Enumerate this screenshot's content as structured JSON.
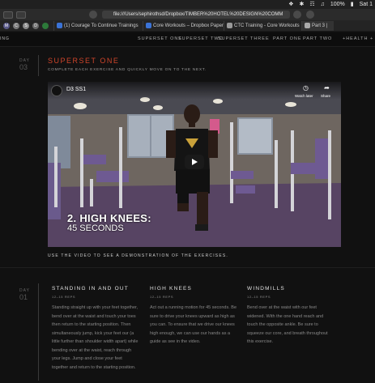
{
  "menubar": {
    "battery": "100%",
    "clock": "Sat 1"
  },
  "toolbar": {
    "address": "file:///Users/sephirothsd/Dropbox/TIMBER%20HOTEL%20DESIGN%20COMM"
  },
  "bookmarks": {
    "favicons": [
      "M",
      "C",
      "S",
      "D"
    ],
    "tabs": [
      {
        "label": "(1) Courage To Continue Trainings"
      },
      {
        "label": "Core Workouts – Dropbox Paper"
      },
      {
        "label": "CTC Training - Core Workouts"
      },
      {
        "label": "Part 3 |"
      }
    ]
  },
  "sitenav": {
    "logo": "ING",
    "links": [
      "SUPERSET ONE",
      "SUPERSET TWO",
      "SUPERSET THREE",
      "PART ONE",
      "PART TWO",
      "+HEALTH +"
    ]
  },
  "section": {
    "day_label": "DAY",
    "day_number": "03",
    "title": "SUPERSET ONE",
    "subtitle": "COMPLETE EACH EXERCISE AND QUICKLY MOVE ON TO THE NEXT."
  },
  "video": {
    "title": "D3 SS1",
    "watch_later": "Watch later",
    "share": "Share",
    "overlay_title": "2. HIGH KNEES:",
    "overlay_subtitle": "45 SECONDS"
  },
  "video_note": "USE THE VIDEO TO SEE A DEMONSTRATION OF THE EXERCISES.",
  "exercises_day": {
    "label": "DAY",
    "number": "01"
  },
  "exercises": [
    {
      "title": "STANDING IN AND OUT",
      "reps": "12–15 REPS",
      "body": "Standing straight up with your feet together, bend over at the waist and touch your toes then return to the starting position. Then simultaneously jump, kick your feet our (a little further than shoulder width apart) while bending over at the waist, reach through your legs. Jump and close your feet together and return to the starting position."
    },
    {
      "title": "HIGH KNEES",
      "reps": "12–15 REPS",
      "body": "Act out a running motion for 45 seconds. Be sure to drive your knees upward as high as you can. To ensure that we drive our knees high enough, we can use our hands as a guide as see in the video."
    },
    {
      "title": "WINDMILLS",
      "reps": "12–15 REPS",
      "body": "Bend over at the waist with our feet widened. With the one hand reach and touch the opposite ankle. Be sure to squeeze our core, and breath throughout this exercise."
    }
  ]
}
